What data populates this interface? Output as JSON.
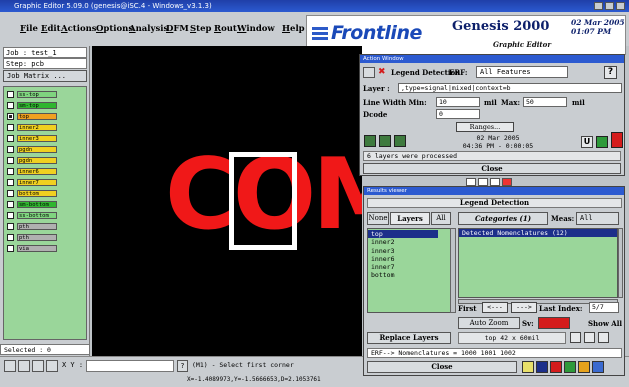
{
  "window": {
    "title": "Graphic Editor 5.09.0 (genesis@iSC.4 - Windows_v3.1.3)"
  },
  "menu": [
    "File",
    "Edit",
    "Actions",
    "Options",
    "Analysis",
    "DFM",
    "Step",
    "Rout",
    "Window",
    "Help"
  ],
  "brand": {
    "logo": "Frontline",
    "product": "Genesis 2000",
    "subtitle": "Graphic Editor",
    "date": "02 Mar 2005",
    "time": "01:07 PM"
  },
  "left_panel": {
    "job": "Job : test_1",
    "step": "Step: pcb",
    "job_matrix": "Job Matrix ...",
    "selected": "Selected : 0",
    "layers": [
      {
        "name": "ss-top",
        "color": "#7fd47f",
        "on": false
      },
      {
        "name": "sm-top",
        "color": "#2fb52f",
        "on": false
      },
      {
        "name": "top",
        "color": "#f0a020",
        "on": true
      },
      {
        "name": "inner2",
        "color": "#f0d020",
        "on": false
      },
      {
        "name": "inner3",
        "color": "#f0d020",
        "on": false
      },
      {
        "name": "pgdn",
        "color": "#f0d020",
        "on": false
      },
      {
        "name": "pgdn",
        "color": "#f0d020",
        "on": false
      },
      {
        "name": "inner6",
        "color": "#f0d020",
        "on": false
      },
      {
        "name": "inner7",
        "color": "#f0d020",
        "on": false
      },
      {
        "name": "bottom",
        "color": "#f0d020",
        "on": false
      },
      {
        "name": "sm-bottom",
        "color": "#2fb52f",
        "on": false
      },
      {
        "name": "ss-bottom",
        "color": "#7fd47f",
        "on": false
      },
      {
        "name": "pth",
        "color": "#b0b0b0",
        "on": false
      },
      {
        "name": "pth",
        "color": "#b0b0b0",
        "on": false
      },
      {
        "name": "via",
        "color": "#b0b0b0",
        "on": false
      }
    ]
  },
  "canvas": {
    "text": "COM",
    "colors": {
      "background": "#000000",
      "feature": "#f01818",
      "highlight": "#ffffff"
    }
  },
  "bottom_bar": {
    "xy_label": "X Y :",
    "hint_icon": "?",
    "hint": "(M1) - Select first corner",
    "coords": "X=-1.4089973,Y=-1.5666653,D=2.1053761"
  },
  "action_window": {
    "title": "Action Window",
    "name": "Legend Detection",
    "erf_label": "ERF:",
    "erf_value": "All Features",
    "help": "?",
    "layer_label": "Layer :",
    "layer_value": ",type=signal|mixed|context=b",
    "line_width_min_label": "Line Width Min:",
    "line_width_min": "10",
    "min_unit": "mil",
    "max_label": "Max:",
    "max_value": "50",
    "max_unit": "mil",
    "dcode_label": "Dcode",
    "dcode_value": "0",
    "ranges": "Ranges...",
    "run_date": "02 Mar 2005",
    "run_time": "04:36 PM - 0:00:05",
    "u_button": "U",
    "status": "6 layers were processed",
    "close": "Close"
  },
  "results_viewer": {
    "title": "Results viewer",
    "heading": "Legend Detection",
    "tabs": [
      "None",
      "Layers",
      "All"
    ],
    "layers": [
      "top",
      "inner2",
      "inner3",
      "inner6",
      "inner7",
      "bottom"
    ],
    "categories_btn": "Categories (1)",
    "meas_label": "Meas:",
    "meas_value": "All",
    "results": [
      "Detected  Nomenclatures (12)"
    ],
    "first": "First",
    "prev": "<---",
    "next": "--->",
    "last": "Last",
    "index_label": "Index:",
    "index_value": "5/7",
    "auto_zoom": "Auto Zoom",
    "sev_label": "Sv:",
    "show_all": "Show All",
    "replace_layers": "Replace Layers",
    "size_info": "top 42 x 60mil",
    "erf_line": "ERF--> Nomenclatures = 1000 1001 1002",
    "close": "Close"
  }
}
